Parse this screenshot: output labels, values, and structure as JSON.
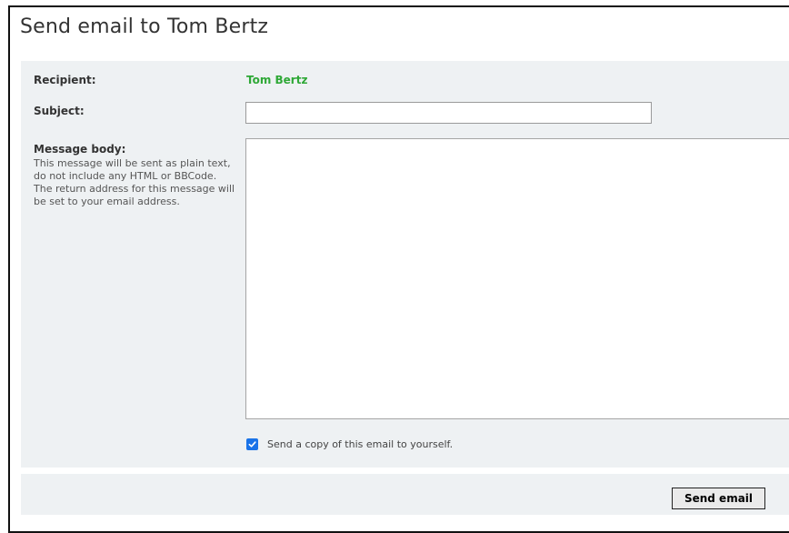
{
  "title": "Send email to Tom Bertz",
  "recipient": {
    "label": "Recipient:",
    "value": "Tom Bertz"
  },
  "subject": {
    "label": "Subject:",
    "value": ""
  },
  "message": {
    "label": "Message body:",
    "hint": "This message will be sent as plain text, do not include any HTML or BBCode. The return address for this message will be set to your email address.",
    "value": ""
  },
  "copy_option": {
    "label": "Send a copy of this email to yourself.",
    "checked": true
  },
  "submit_label": "Send email",
  "colors": {
    "recipient_name": "#2ea836",
    "checkbox_accent": "#1a73e8",
    "panel_background": "#eef1f3"
  }
}
